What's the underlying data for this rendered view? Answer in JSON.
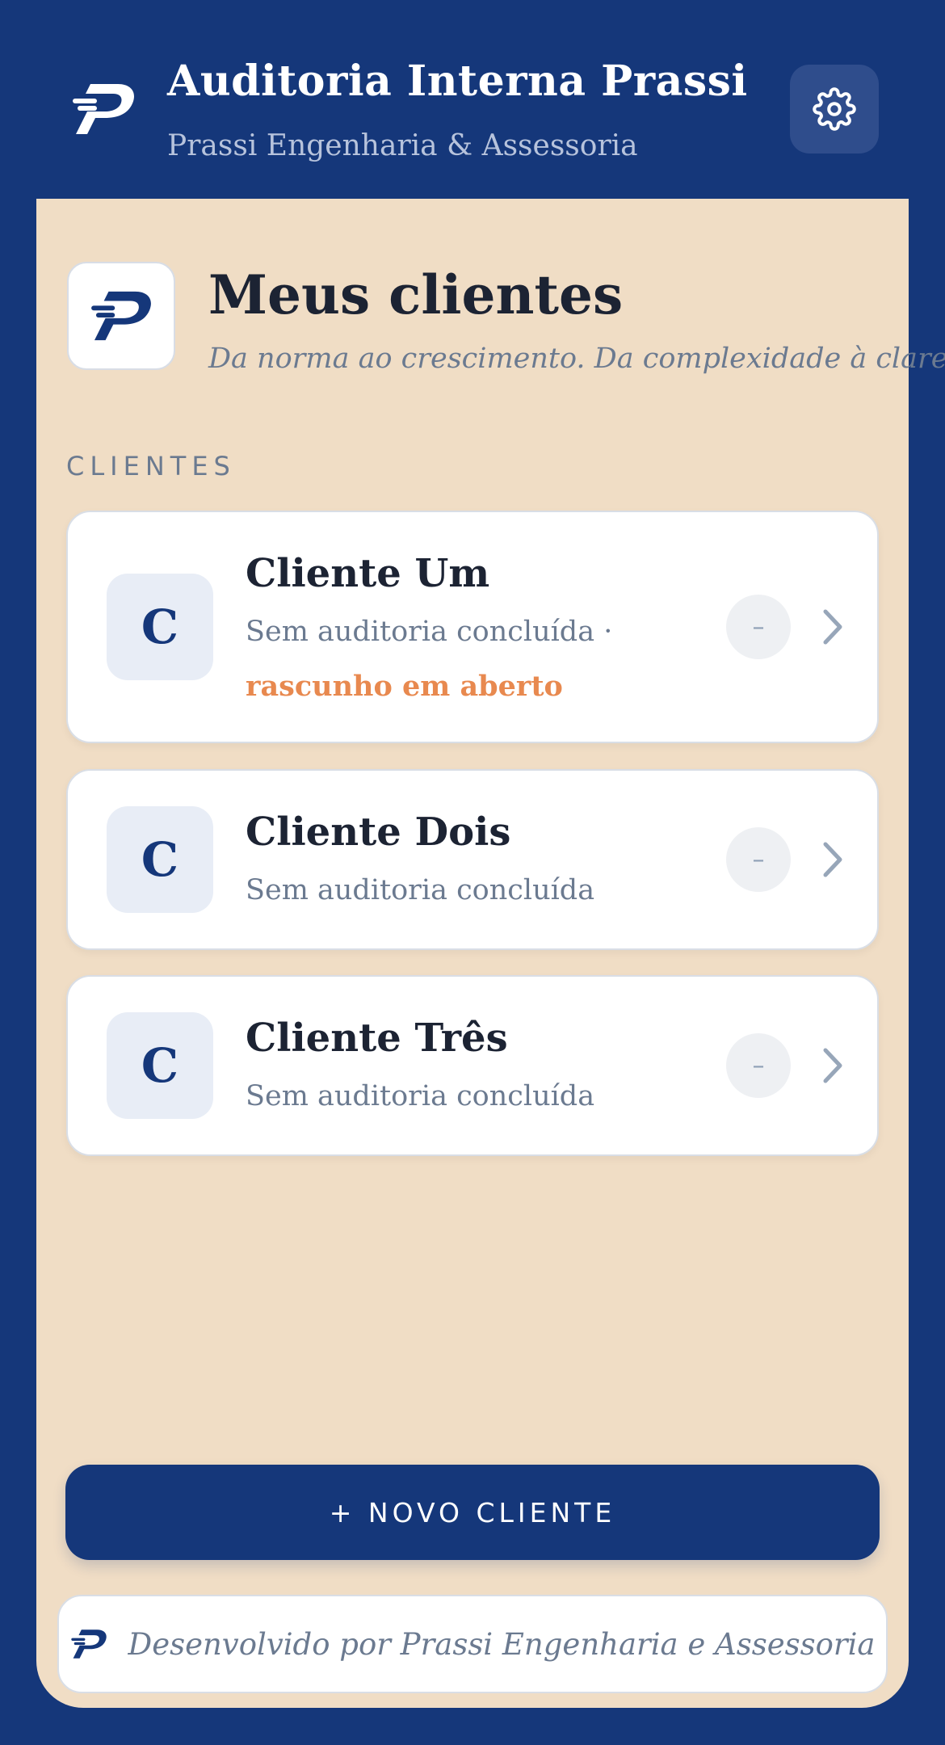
{
  "header": {
    "title": "Auditoria Interna Prassi",
    "subtitle": "Prassi Engenharia & Assessoria",
    "logo_icon": "prassi-logo-icon",
    "settings_icon": "gear-icon"
  },
  "hero": {
    "title": "Meus clientes",
    "tagline": "Da norma ao crescimento. Da complexidade à clareza."
  },
  "section_label": "CLIENTES",
  "clients": [
    {
      "initial": "C",
      "name": "Cliente Um",
      "status": "Sem auditoria concluída",
      "separator": " · ",
      "draft": "rascunho em aberto",
      "score": "–"
    },
    {
      "initial": "C",
      "name": "Cliente Dois",
      "status": "Sem auditoria concluída",
      "score": "–"
    },
    {
      "initial": "C",
      "name": "Cliente Três",
      "status": "Sem auditoria concluída",
      "score": "–"
    }
  ],
  "new_client_button": "+ NOVO CLIENTE",
  "footer": {
    "text": "Desenvolvido por Prassi Engenharia e Assessoria"
  },
  "colors": {
    "brand_navy": "#15377a",
    "panel_beige": "#f0ddc5",
    "draft_orange": "#e8894f",
    "muted_text": "#6b7a90"
  }
}
